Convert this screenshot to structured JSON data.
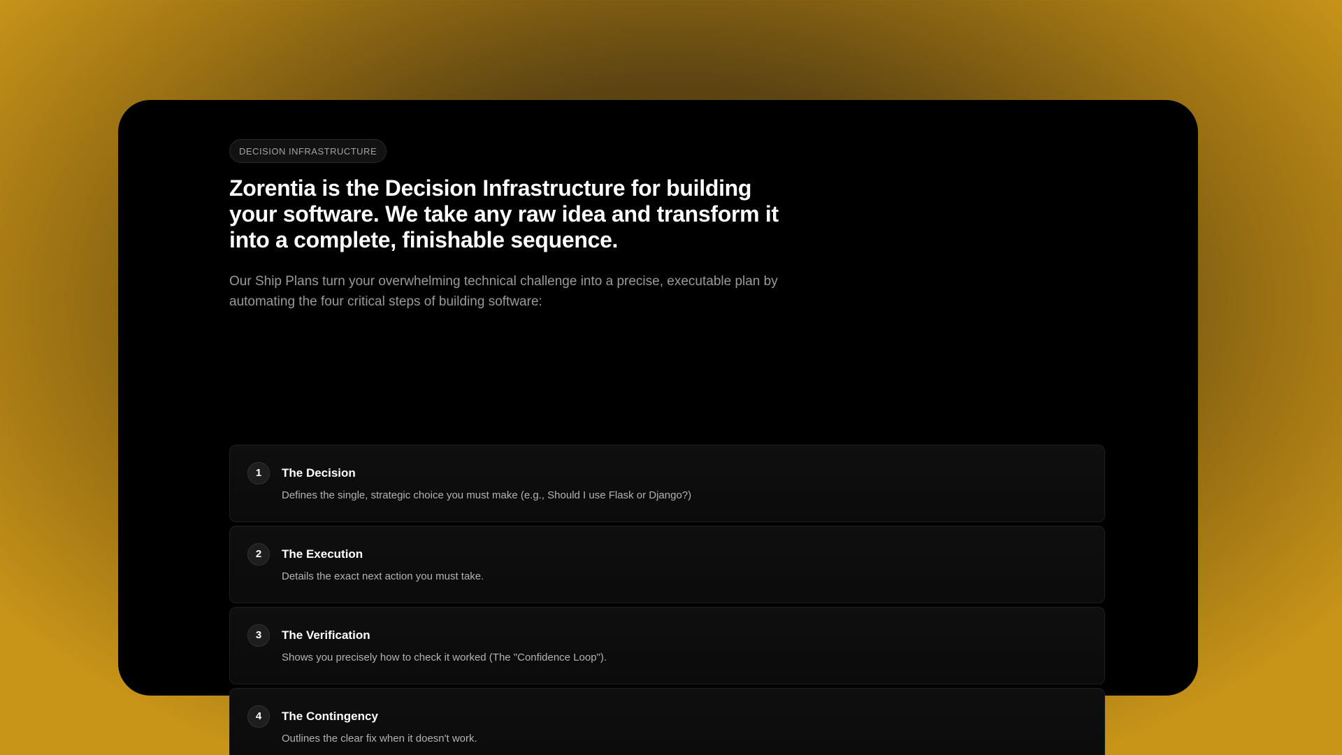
{
  "badge": "DECISION INFRASTRUCTURE",
  "headline": "Zorentia is the Decision Infrastructure for building your software. We take any raw idea and transform it into a complete, finishable sequence.",
  "subtext": "Our Ship Plans turn your overwhelming technical challenge into a precise, executable plan by automating the four critical steps of building software:",
  "steps": [
    {
      "number": "1",
      "title": "The Decision",
      "description": "Defines the single, strategic choice you must make (e.g., Should I use Flask or Django?)"
    },
    {
      "number": "2",
      "title": "The Execution",
      "description": "Details the exact next action you must take."
    },
    {
      "number": "3",
      "title": "The Verification",
      "description": "Shows you precisely how to check it worked (The \"Confidence Loop\")."
    },
    {
      "number": "4",
      "title": "The Contingency",
      "description": "Outlines the clear fix when it doesn't work."
    }
  ],
  "colors": {
    "background_outer": "#c99519",
    "panel": "#000000",
    "text_primary": "#ffffff",
    "text_secondary": "#9a9a9a"
  }
}
